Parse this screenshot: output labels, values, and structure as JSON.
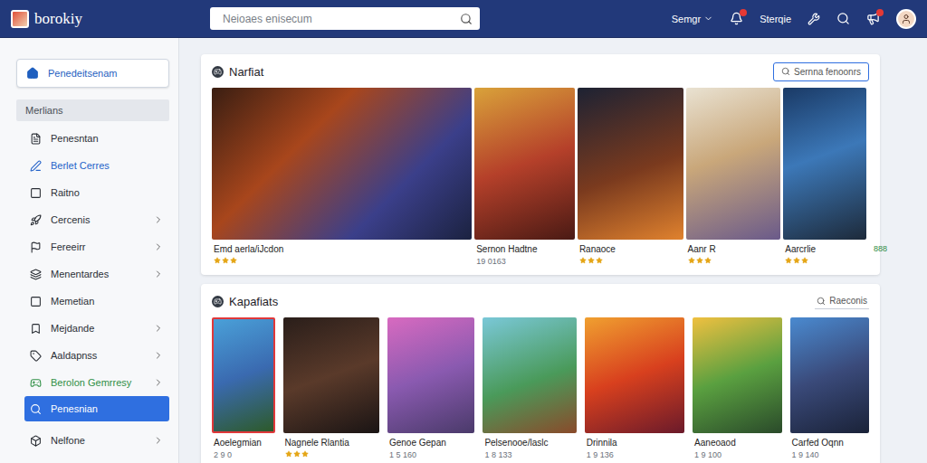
{
  "app": {
    "title": "borokiy"
  },
  "search": {
    "placeholder": "Neioaes enisecum"
  },
  "topbar": {
    "user_menu": "Semgr",
    "link": "Sterqie",
    "alerts_badge": true,
    "messages_badge": true
  },
  "sidebar": {
    "items": [
      {
        "label": "Penedeitsenam",
        "kind": "button",
        "selected": false,
        "expandable": false,
        "color": "#1f5fbf"
      },
      {
        "label": "Merlians",
        "kind": "header",
        "selected": false,
        "expandable": false,
        "color": "#4a4f57"
      },
      {
        "label": "Penesntan",
        "kind": "item",
        "selected": false,
        "expandable": false,
        "color": "#2b2f36"
      },
      {
        "label": "Berlet Cerres",
        "kind": "item",
        "selected": false,
        "expandable": false,
        "color": "#2563c9"
      },
      {
        "label": "Raitno",
        "kind": "item",
        "selected": false,
        "expandable": false,
        "color": "#2b2f36"
      },
      {
        "label": "Cercenis",
        "kind": "item",
        "selected": false,
        "expandable": true,
        "color": "#2b2f36"
      },
      {
        "label": "Fereeirr",
        "kind": "item",
        "selected": false,
        "expandable": true,
        "color": "#2b2f36"
      },
      {
        "label": "Menentardes",
        "kind": "item",
        "selected": false,
        "expandable": true,
        "color": "#2b2f36"
      },
      {
        "label": "Memetian",
        "kind": "item",
        "selected": false,
        "expandable": false,
        "color": "#2b2f36"
      },
      {
        "label": "Mejdande",
        "kind": "item",
        "selected": false,
        "expandable": true,
        "color": "#2b2f36"
      },
      {
        "label": "Aaldapnss",
        "kind": "item",
        "selected": false,
        "expandable": true,
        "color": "#2b2f36"
      },
      {
        "label": "Berolon Gemrresy",
        "kind": "item",
        "selected": false,
        "expandable": true,
        "color": "#2f8f45"
      },
      {
        "label": "Penesnian",
        "kind": "item",
        "selected": true,
        "expandable": false,
        "color": "#2b2f36"
      },
      {
        "label": "Nelfone",
        "kind": "item",
        "selected": false,
        "expandable": true,
        "color": "#2b2f36"
      }
    ]
  },
  "featured": {
    "title": "Narfiat",
    "action": "Sernna fenoonrs",
    "items": [
      {
        "title": "Emd aerla/iJcdon",
        "kind": "stars",
        "stars": 3
      },
      {
        "title": "Sernon Hadtne",
        "kind": "text",
        "sub": "19 0163"
      },
      {
        "title": "Ranaoce",
        "kind": "stars",
        "stars": 3
      },
      {
        "title": "Aanr R",
        "kind": "stars",
        "stars": 3
      },
      {
        "title": "Aarcrlie",
        "kind": "stars",
        "stars": 3
      },
      {
        "kind": "badge",
        "badge": "888"
      }
    ]
  },
  "popular": {
    "title": "Kapafiats",
    "action": "Raeconis",
    "items": [
      {
        "title": "Aoelegmian",
        "kind": "text",
        "sub": "2 9 0",
        "selected": true
      },
      {
        "title": "Nagnele Rlantia",
        "kind": "stars",
        "stars": 3,
        "selected": false
      },
      {
        "title": "Genoe Gepan",
        "kind": "text",
        "sub": "1 5 160",
        "selected": false
      },
      {
        "title": "Pelsenooe/laslc",
        "kind": "text",
        "sub": "1 8 133",
        "selected": false
      },
      {
        "title": "Drinnila",
        "kind": "text",
        "sub": "1 9 136",
        "selected": false
      },
      {
        "title": "Aaneoaod",
        "kind": "text",
        "sub": "1 9 100",
        "selected": false
      },
      {
        "title": "Carfed Oqnn",
        "kind": "text",
        "sub": "1 9 140",
        "selected": false
      }
    ]
  }
}
